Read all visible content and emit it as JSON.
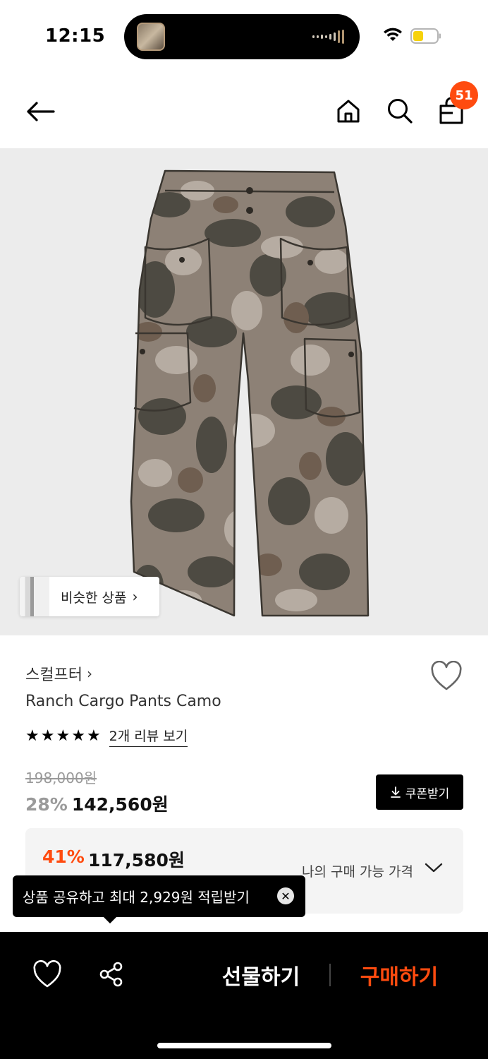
{
  "status_bar": {
    "time": "12:15"
  },
  "header": {
    "cart_count": "51"
  },
  "product": {
    "similar_label": "비슷한 상품",
    "brand": "스컬프터",
    "name": "Ranch Cargo Pants Camo",
    "rating_stars": 5,
    "review_link": "2개 리뷰 보기",
    "original_price": "198,000원",
    "discount_rate": "28%",
    "sale_price": "142,560원",
    "coupon_label": "쿠폰받기"
  },
  "my_price": {
    "discount_rate": "41%",
    "price": "117,580원",
    "label": "나의 구매 가능 가격"
  },
  "tooltip": {
    "text": "상품 공유하고 최대 2,929원 적립받기"
  },
  "bottom_bar": {
    "gift_label": "선물하기",
    "buy_label": "구매하기"
  },
  "colors": {
    "accent": "#ff4b0f",
    "image_bg": "#ececec",
    "bar_bg": "#000000"
  }
}
